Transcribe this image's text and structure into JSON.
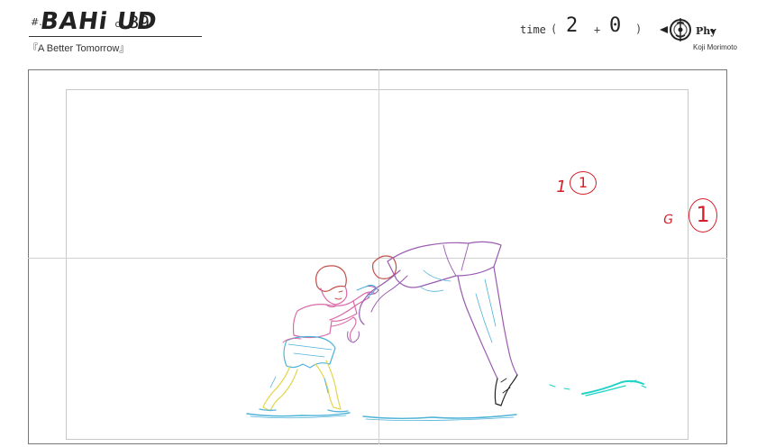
{
  "header": {
    "hash_mark": "#.",
    "title": "BAHi UD",
    "cut_label": "c.",
    "cut_number": "39",
    "subtitle": "『A Better Tomorrow』"
  },
  "time": {
    "label": "time",
    "open": "(",
    "seconds": "2",
    "plus": "+",
    "frames": "0",
    "close": ")"
  },
  "logo": {
    "text": "Phy",
    "icon": "studio-emblem-icon"
  },
  "credit": "Koji Morimoto",
  "notes": {
    "a_digit": "1",
    "a_circled": "1",
    "b_letter": "G",
    "b_circled": "1"
  },
  "colors": {
    "annotation_red": "#d21f2a",
    "figure_boy_pink": "#d86aa8",
    "figure_boy_blue": "#4fb3d9",
    "figure_boy_yellow": "#e4d64a",
    "figure_man_purple": "#9a5cb0",
    "water_cyan": "#1fd3c6"
  }
}
